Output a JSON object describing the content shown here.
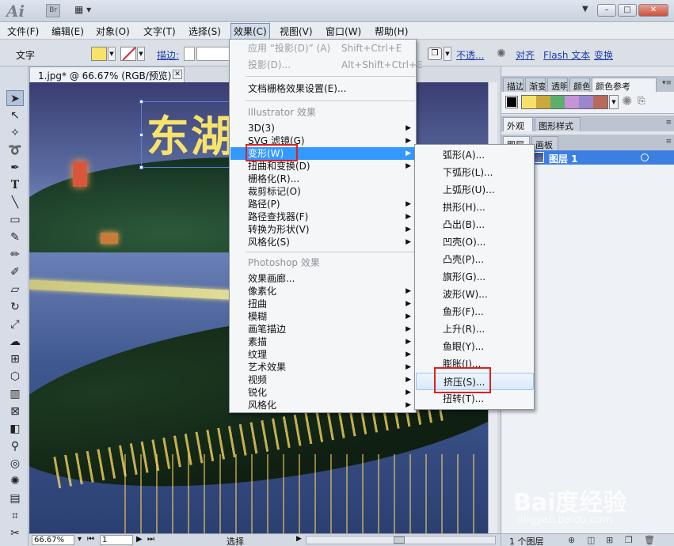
{
  "titlebar": {
    "app_logo": "Ai",
    "bridge_label": "Br",
    "window_buttons": {
      "minimize": "–",
      "restore": "□",
      "close": "✕"
    }
  },
  "menubar": {
    "items": [
      "文件(F)",
      "编辑(E)",
      "对象(O)",
      "文字(T)",
      "选择(S)",
      "效果(C)",
      "视图(V)",
      "窗口(W)",
      "帮助(H)"
    ],
    "active_index": 5
  },
  "controlbar": {
    "label": "文字",
    "stroke_label": "描边:",
    "opacity_label": "不透...",
    "align_label": "对齐",
    "flash_text_label": "Flash 文本",
    "transform_label": "变换",
    "fill_color": "#f8e36a"
  },
  "document": {
    "tab_title": "1.jpg* @ 66.67% (RGB/预览)",
    "canvas_text": "东湖",
    "zoom": "66.67%",
    "page": "1",
    "status_text": "选择"
  },
  "effect_menu": {
    "items": [
      {
        "label": "应用 “投影(D)” (A)",
        "shortcut": "Shift+Ctrl+E",
        "disabled": true
      },
      {
        "label": "投影(D)...",
        "shortcut": "Alt+Shift+Ctrl+E",
        "disabled": true
      },
      {
        "label": "文档栅格效果设置(E)..."
      },
      {
        "label": "Illustrator 效果",
        "section": true
      },
      {
        "label": "3D(3)",
        "submenu": true
      },
      {
        "label": "SVG 滤镜(G)",
        "submenu": true
      },
      {
        "label": "变形(W)",
        "submenu": true,
        "highlight": true
      },
      {
        "label": "扭曲和变换(D)",
        "submenu": true
      },
      {
        "label": "栅格化(R)..."
      },
      {
        "label": "裁剪标记(O)"
      },
      {
        "label": "路径(P)",
        "submenu": true
      },
      {
        "label": "路径查找器(F)",
        "submenu": true
      },
      {
        "label": "转换为形状(V)",
        "submenu": true
      },
      {
        "label": "风格化(S)",
        "submenu": true
      },
      {
        "label": "Photoshop 效果",
        "section": true
      },
      {
        "label": "效果画廊..."
      },
      {
        "label": "像素化",
        "submenu": true
      },
      {
        "label": "扭曲",
        "submenu": true
      },
      {
        "label": "模糊",
        "submenu": true
      },
      {
        "label": "画笔描边",
        "submenu": true
      },
      {
        "label": "素描",
        "submenu": true
      },
      {
        "label": "纹理",
        "submenu": true
      },
      {
        "label": "艺术效果",
        "submenu": true
      },
      {
        "label": "视频",
        "submenu": true
      },
      {
        "label": "锐化",
        "submenu": true
      },
      {
        "label": "风格化",
        "submenu": true
      }
    ]
  },
  "warp_submenu": {
    "items": [
      "弧形(A)...",
      "下弧形(L)...",
      "上弧形(U)...",
      "拱形(H)...",
      "凸出(B)...",
      "凹壳(O)...",
      "凸壳(P)...",
      "旗形(G)...",
      "波形(W)...",
      "鱼形(F)...",
      "上升(R)...",
      "鱼眼(Y)...",
      "膨胀(I)...",
      "挤压(S)...",
      "扭转(T)..."
    ],
    "hover_index": 13
  },
  "panels": {
    "top_tabs": [
      "描边",
      "渐变",
      "透明",
      "颜色",
      "颜色参考"
    ],
    "guide_colors": [
      "#c9a83c",
      "#5cae6e",
      "#c593d6",
      "#9b86cf",
      "#b86a5a"
    ],
    "middle_tabs": [
      "外观",
      "图形样式"
    ],
    "layer_tabs": [
      "图层",
      "画板"
    ],
    "layer_name": "图层 1",
    "layers_count": "1 个图层"
  },
  "watermark": {
    "brand": "Bai度经验",
    "sub": "jingyan.baidu.com"
  },
  "colors": {
    "menu_highlight": "#3399ff",
    "annotation_red": "#e02020",
    "canvas_text": "#f7e36a"
  }
}
